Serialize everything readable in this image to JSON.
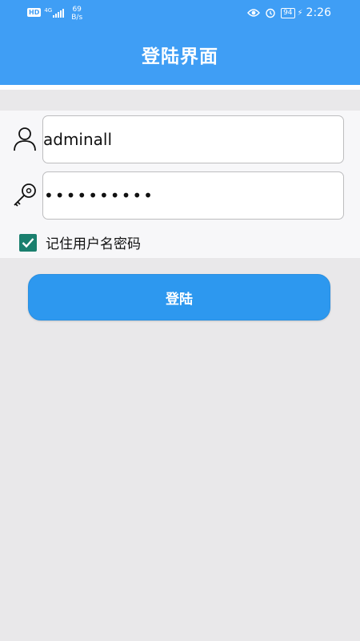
{
  "status_bar": {
    "hd_badge": "HD",
    "network_type": "4G",
    "speed_value": "69",
    "speed_unit": "B/s",
    "battery": "94",
    "time": "2:26"
  },
  "app_bar": {
    "title": "登陆界面"
  },
  "form": {
    "username_value": "adminall",
    "password_value": "••••••••••",
    "remember_label": "记住用户名密码",
    "remember_checked": true
  },
  "login_button": {
    "label": "登陆"
  },
  "colors": {
    "primary": "#3f9ef5",
    "button": "#2d98ef",
    "checkbox": "#1a7f6e",
    "background": "#e9e8ea"
  },
  "icons": [
    "eye-icon",
    "alarm-icon",
    "battery-icon",
    "user-icon",
    "key-icon",
    "checkmark-icon"
  ]
}
